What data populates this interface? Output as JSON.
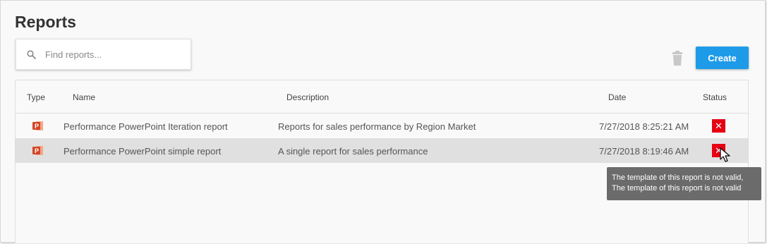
{
  "page": {
    "title": "Reports"
  },
  "search": {
    "placeholder": "Find reports...",
    "value": "",
    "icon": "search-icon"
  },
  "toolbar": {
    "delete_icon": "trash-icon",
    "create_label": "Create",
    "accent": "#1e9be8"
  },
  "table": {
    "columns": [
      "Type",
      "Name",
      "Description",
      "Date",
      "Status"
    ],
    "rows": [
      {
        "type_icon": "powerpoint-icon",
        "name": "Performance PowerPoint Iteration report",
        "description": "Reports for sales performance by Region Market",
        "date": "7/27/2018 8:25:21 AM",
        "status_icon": "error-icon",
        "status_color": "#e60012"
      },
      {
        "type_icon": "powerpoint-icon",
        "name": "Performance PowerPoint simple report",
        "description": "A single report for sales performance",
        "date": "7/27/2018 8:19:46 AM",
        "status_icon": "error-icon",
        "status_color": "#e60012",
        "selected": true
      }
    ]
  },
  "tooltip": {
    "line1": "The template of this report is not valid,",
    "line2": "The template of this report is not valid"
  }
}
